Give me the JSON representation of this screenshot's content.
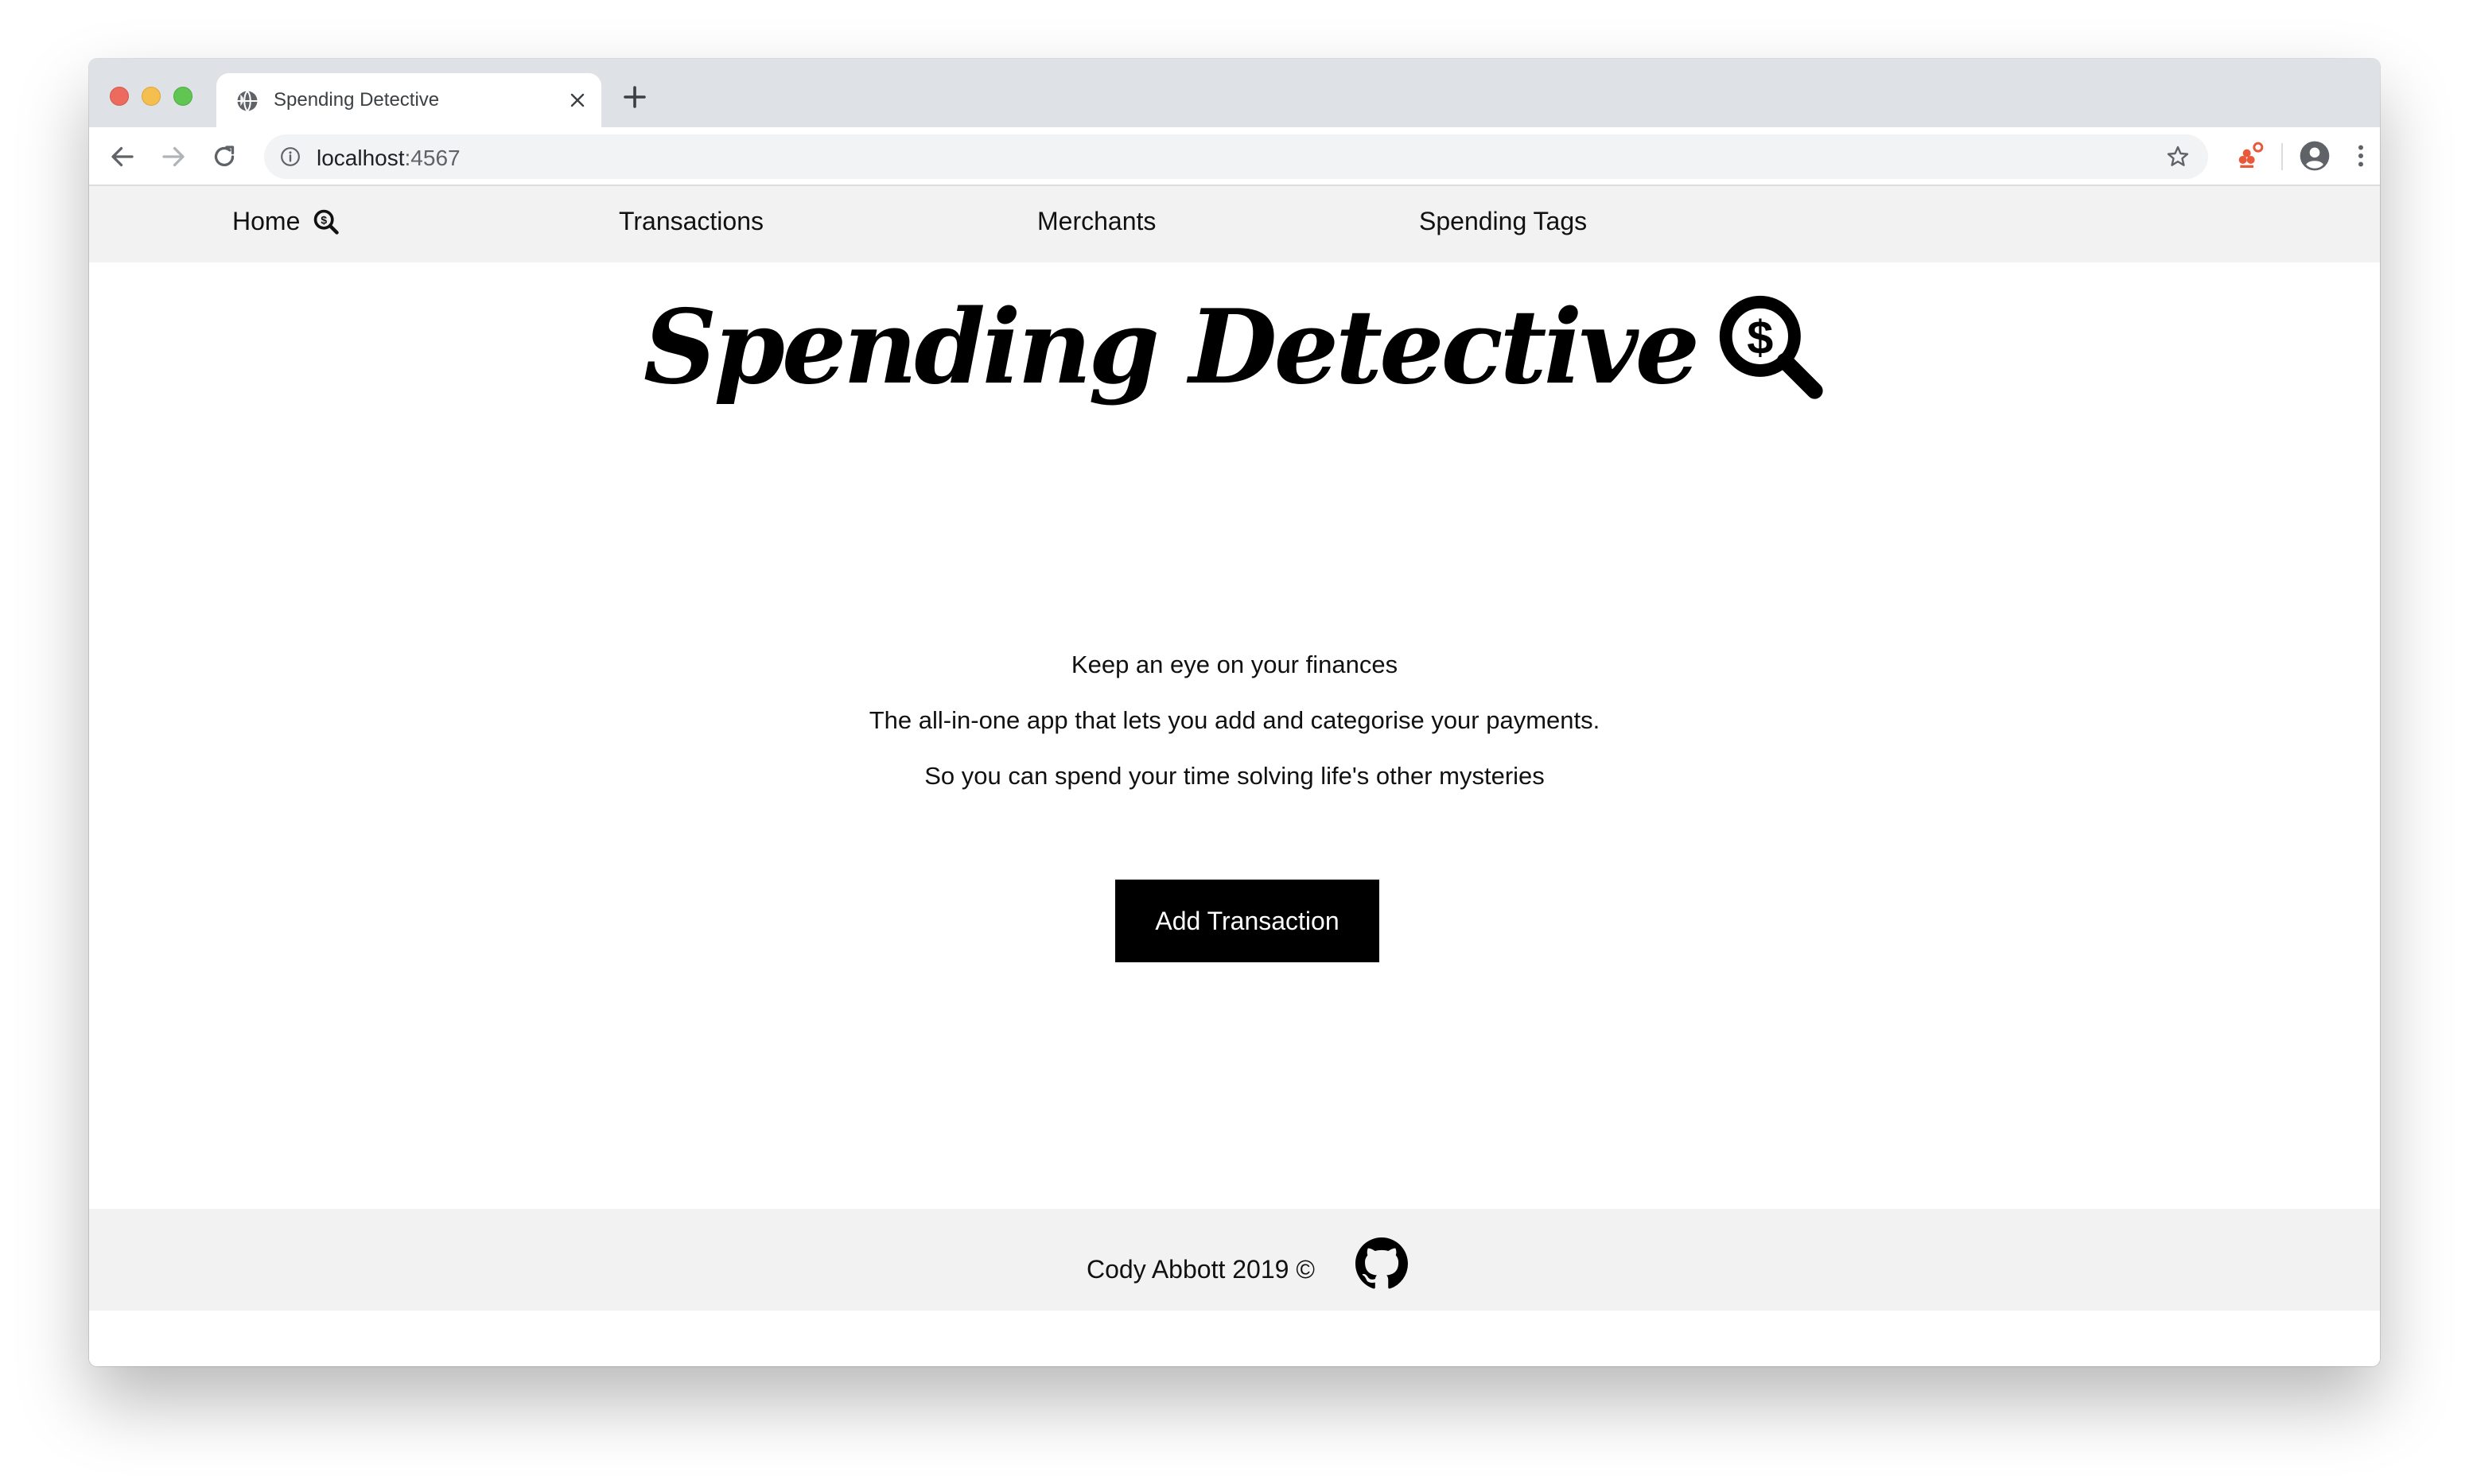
{
  "browser": {
    "tab_title": "Spending Detective",
    "url_host": "localhost",
    "url_port": ":4567"
  },
  "nav": {
    "home": "Home",
    "transactions": "Transactions",
    "merchants": "Merchants",
    "spending_tags": "Spending Tags"
  },
  "hero": {
    "title": "Spending Detective",
    "icon": "magnifier-dollar-icon"
  },
  "taglines": [
    "Keep an eye on your finances",
    "The all-in-one app that lets you add and categorise your payments.",
    "So you can spend your time solving life's other mysteries"
  ],
  "cta": {
    "add_transaction": "Add Transaction"
  },
  "footer": {
    "text": "Cody Abbott 2019 ©",
    "icon": "github-icon"
  },
  "colors": {
    "nav_background": "#f2f2f2",
    "button_background": "#000000",
    "button_text": "#ffffff"
  }
}
